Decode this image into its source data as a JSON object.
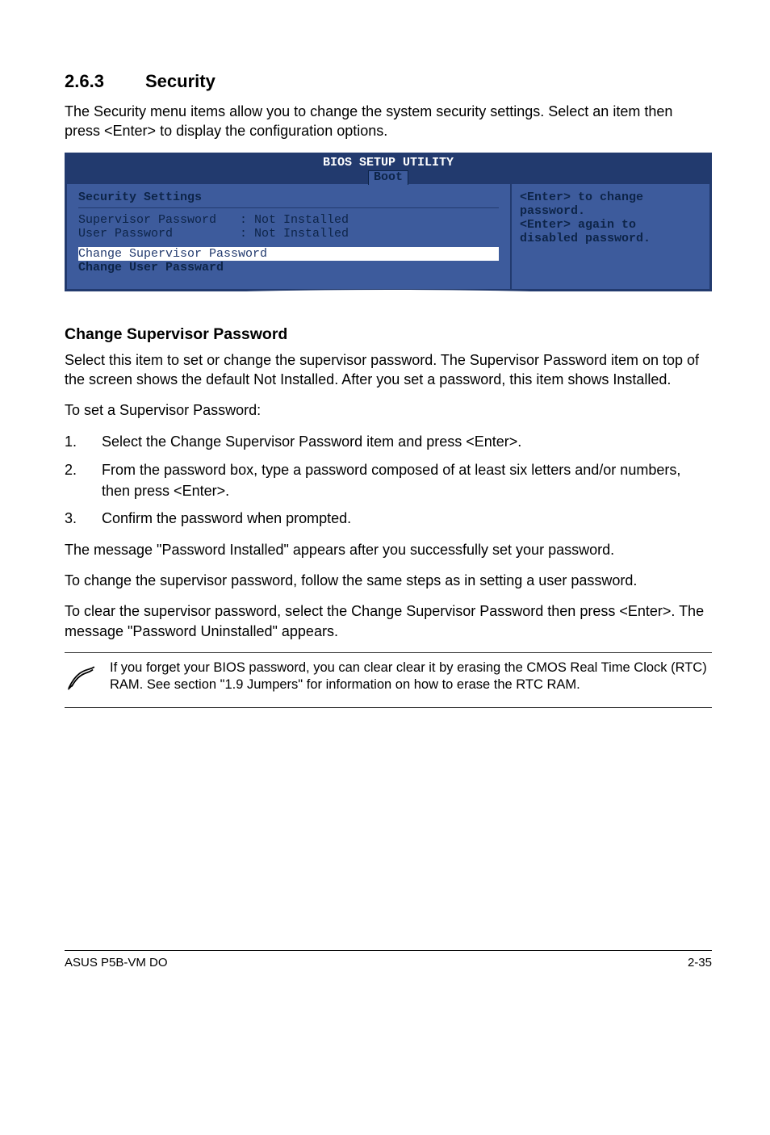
{
  "heading": {
    "number": "2.6.3",
    "title": "Security"
  },
  "intro": "The Security menu items allow you to change the system security settings. Select an item then press <Enter> to display the configuration options.",
  "bios": {
    "title": "BIOS SETUP UTILITY",
    "tab": "Boot",
    "settings_title": "Security Settings",
    "rows": [
      {
        "label": "Supervisor Password",
        "value": ": Not Installed"
      },
      {
        "label": "User Password",
        "value": ": Not Installed"
      }
    ],
    "highlight": "Change Supervisor Password",
    "below_highlight": "Change User Passward",
    "help": {
      "l1": "<Enter> to change",
      "l2": "password.",
      "l3": "<Enter> again to",
      "l4": "disabled password."
    }
  },
  "subheading": "Change Supervisor Password",
  "p1": "Select this item to set or change the supervisor password. The Supervisor Password item on top of the screen shows the default Not Installed. After you set a password, this item shows Installed.",
  "p2": "To set a Supervisor Password:",
  "steps": {
    "n1": "1.",
    "s1": "Select the Change Supervisor Password item and press <Enter>.",
    "n2": "2.",
    "s2": "From the password box, type a password composed of at least six letters and/or numbers, then press <Enter>.",
    "n3": "3.",
    "s3": "Confirm the password when prompted."
  },
  "p3": "The message \"Password Installed\" appears after you successfully set your password.",
  "p4": "To change the supervisor password, follow the same steps as in setting a user password.",
  "p5": "To clear the supervisor password, select the Change Supervisor Password then press <Enter>. The message \"Password Uninstalled\" appears.",
  "note": "If you forget your BIOS password, you can clear clear it by erasing the CMOS Real Time Clock (RTC) RAM. See section \"1.9 Jumpers\" for information on how to erase the RTC RAM.",
  "footer": {
    "left": "ASUS P5B-VM DO",
    "right": "2-35"
  }
}
